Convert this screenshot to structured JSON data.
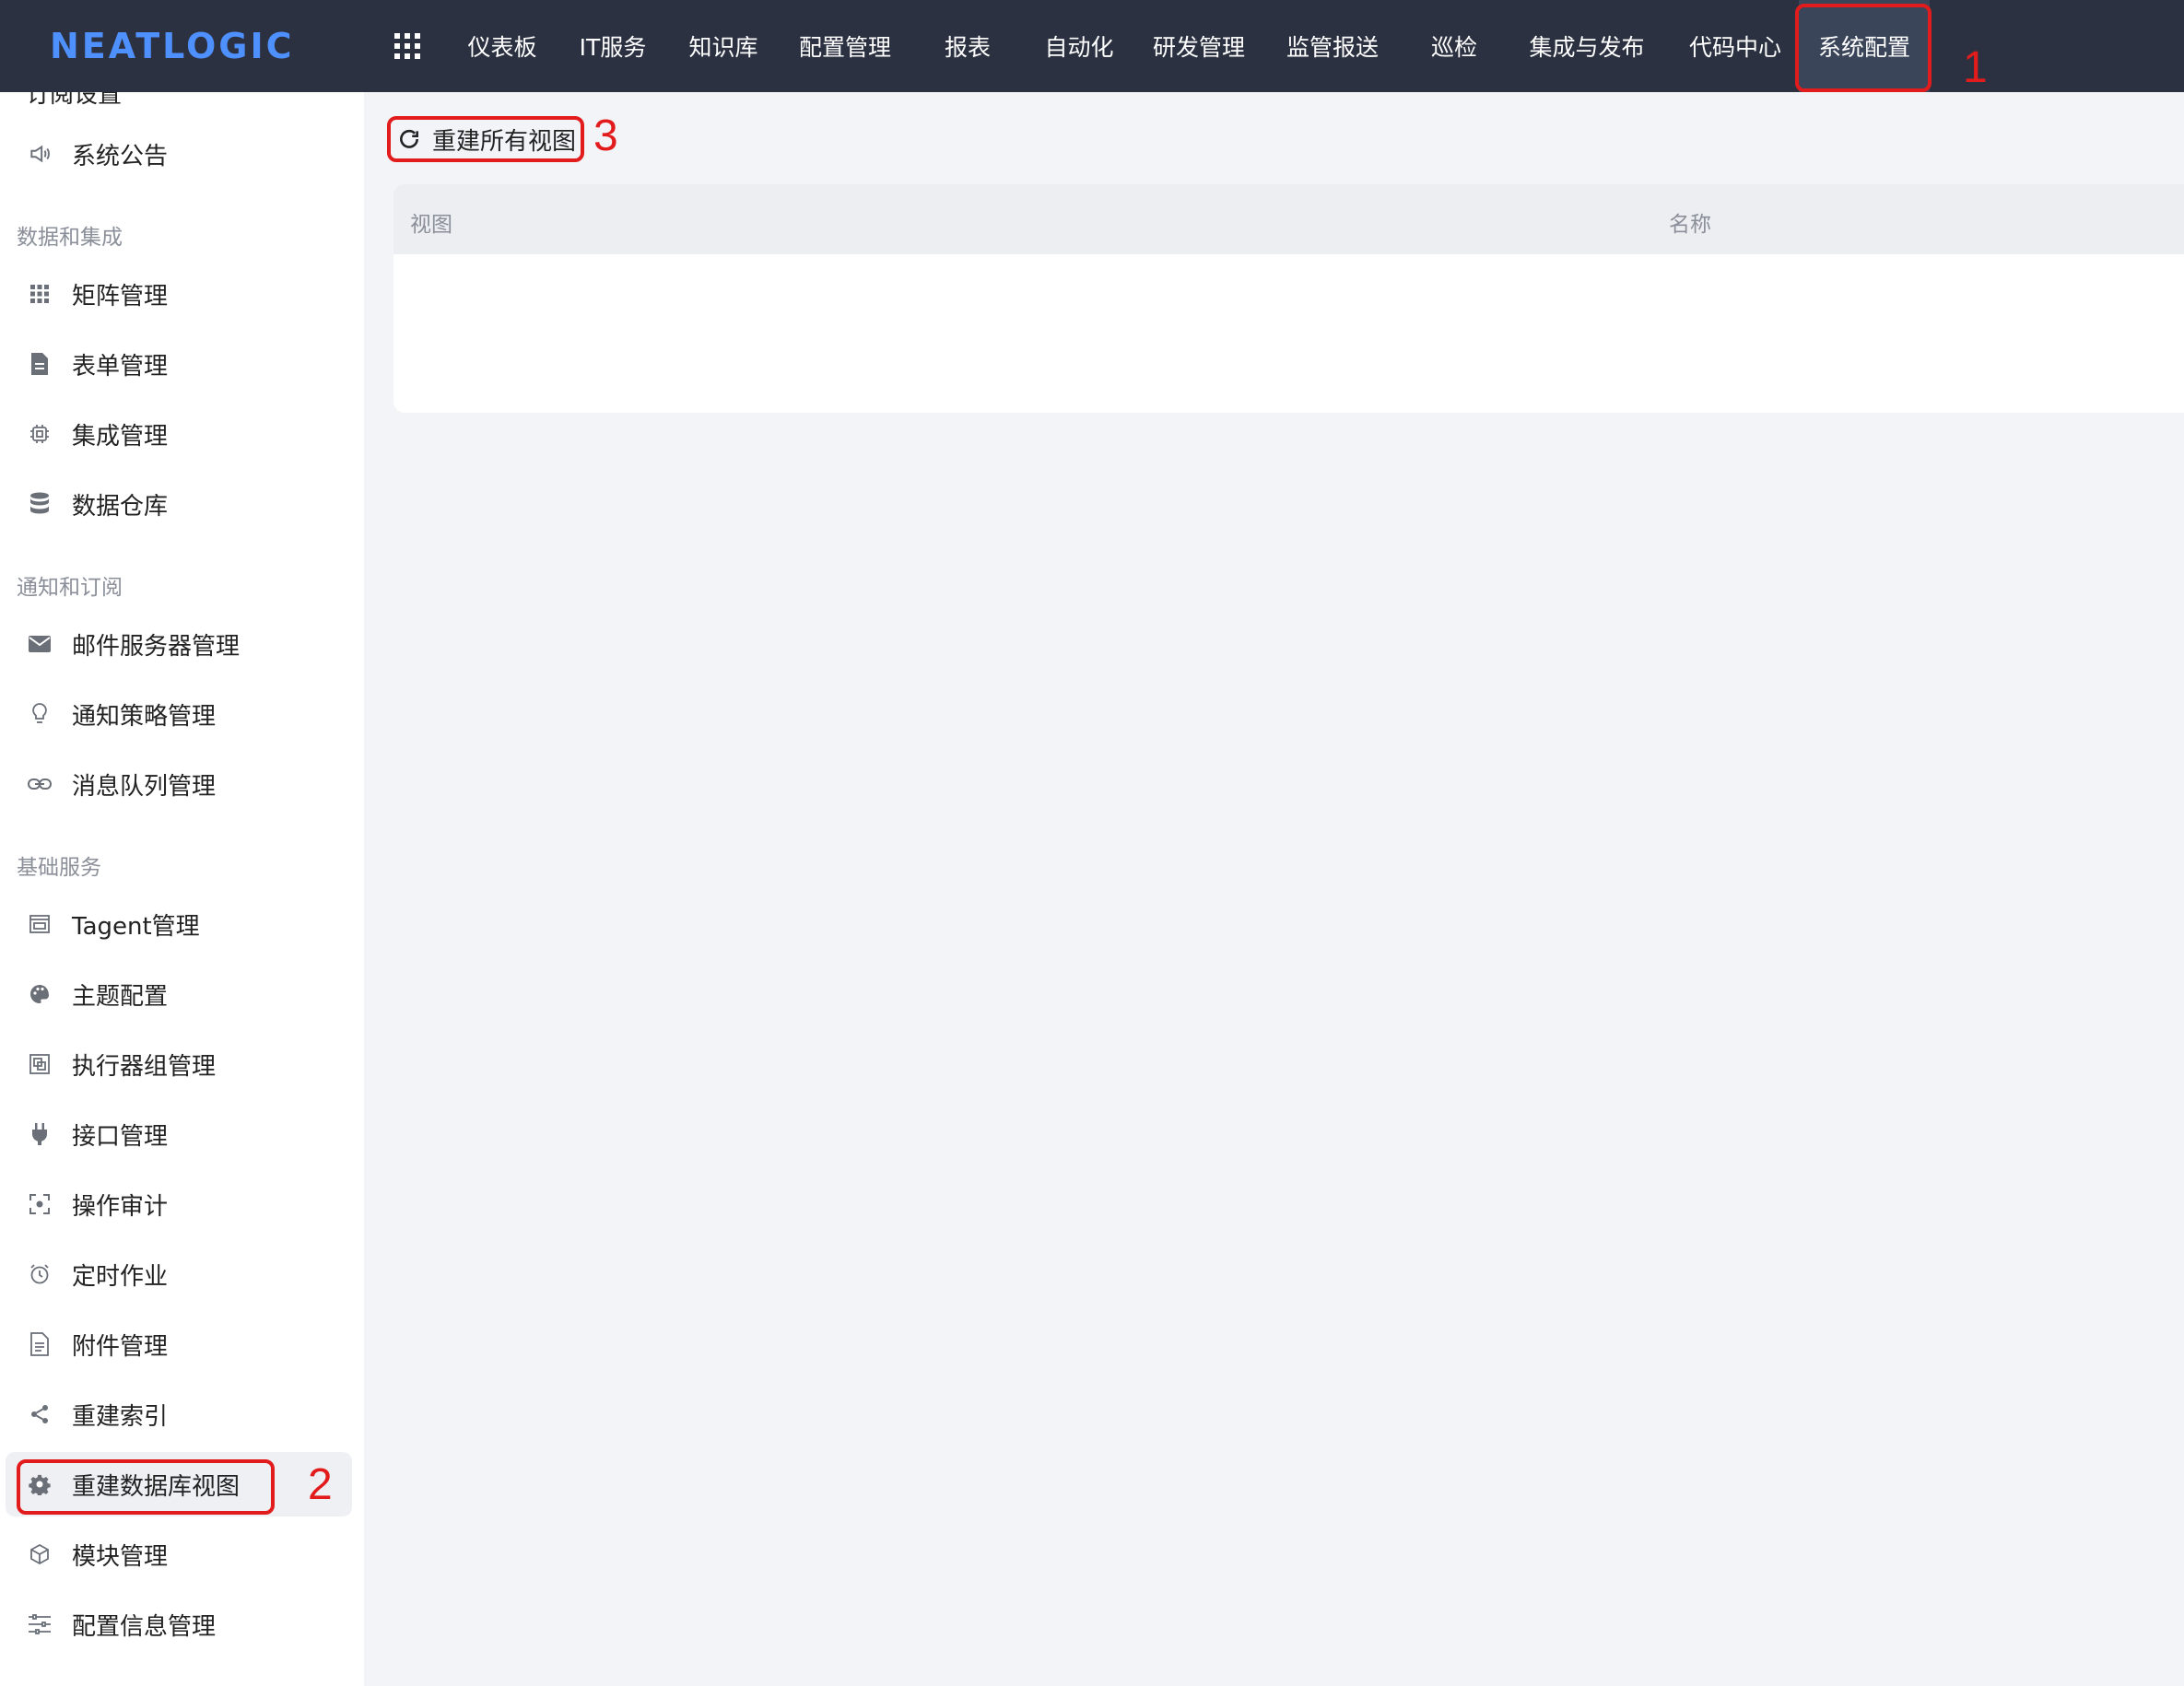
{
  "app": {
    "logo": "NEATLOGIC"
  },
  "nav": {
    "items": [
      {
        "label": "仪表板"
      },
      {
        "label": "IT服务"
      },
      {
        "label": "知识库"
      },
      {
        "label": "配置管理"
      },
      {
        "label": "报表"
      },
      {
        "label": "自动化"
      },
      {
        "label": "研发管理"
      },
      {
        "label": "监管报送"
      },
      {
        "label": "巡检"
      },
      {
        "label": "集成与发布"
      },
      {
        "label": "代码中心"
      },
      {
        "label": "系统配置",
        "active": true
      }
    ]
  },
  "annotations": [
    "1",
    "2",
    "3"
  ],
  "sidebar": {
    "cut_label": "订阅设置",
    "top_items": [
      {
        "label": "系统公告",
        "icon": "speaker-icon"
      }
    ],
    "groups": [
      {
        "label": "数据和集成",
        "items": [
          {
            "label": "矩阵管理",
            "icon": "grid-icon"
          },
          {
            "label": "表单管理",
            "icon": "document-icon"
          },
          {
            "label": "集成管理",
            "icon": "chip-icon"
          },
          {
            "label": "数据仓库",
            "icon": "database-icon"
          }
        ]
      },
      {
        "label": "通知和订阅",
        "items": [
          {
            "label": "邮件服务器管理",
            "icon": "mail-icon"
          },
          {
            "label": "通知策略管理",
            "icon": "bulb-icon"
          },
          {
            "label": "消息队列管理",
            "icon": "link-icon"
          }
        ]
      },
      {
        "label": "基础服务",
        "items": [
          {
            "label": "Tagent管理",
            "icon": "window-icon"
          },
          {
            "label": "主题配置",
            "icon": "palette-icon"
          },
          {
            "label": "执行器组管理",
            "icon": "stack-icon"
          },
          {
            "label": "接口管理",
            "icon": "plug-icon"
          },
          {
            "label": "操作审计",
            "icon": "focus-icon"
          },
          {
            "label": "定时作业",
            "icon": "alarm-icon"
          },
          {
            "label": "附件管理",
            "icon": "file-icon"
          },
          {
            "label": "重建索引",
            "icon": "share-icon"
          },
          {
            "label": "重建数据库视图",
            "icon": "gear-icon",
            "active": true
          },
          {
            "label": "模块管理",
            "icon": "cube-icon"
          },
          {
            "label": "配置信息管理",
            "icon": "sliders-icon"
          }
        ]
      }
    ]
  },
  "main": {
    "rebuild_button": "重建所有视图",
    "table": {
      "columns": [
        "视图",
        "名称"
      ],
      "rows": []
    }
  }
}
